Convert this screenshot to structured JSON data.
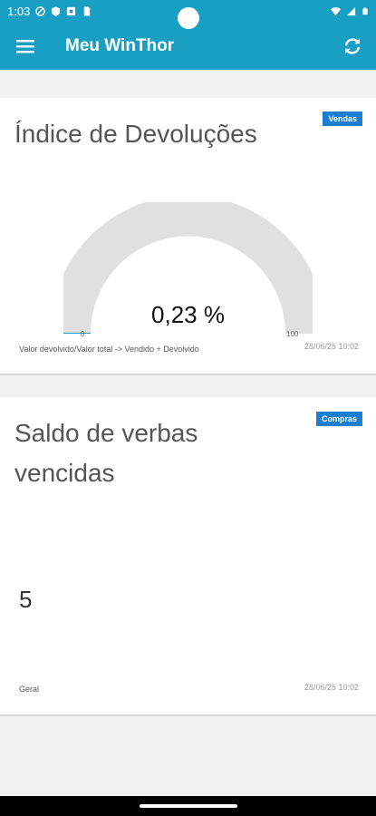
{
  "status_bar": {
    "time": "1:03"
  },
  "app_bar": {
    "title": "Meu WinThor"
  },
  "cards": [
    {
      "badge": "Vendas",
      "title": "Índice de Devoluções",
      "gauge": {
        "value_text": "0,23 %",
        "value": 0.23,
        "min": "0",
        "max": "100"
      },
      "footnote": "Valor devolvido/Valor total -> Vendido + Devolvido",
      "timestamp": "28/06/25 10:02"
    },
    {
      "badge": "Compras",
      "title": "Saldo de verbas vencidas",
      "value": "5",
      "footnote": "Geral",
      "timestamp": "28/06/25 10:02"
    }
  ],
  "colors": {
    "primary": "#1a9fc4",
    "badge": "#1a7fd0",
    "gauge_track": "#e0e0e0"
  }
}
